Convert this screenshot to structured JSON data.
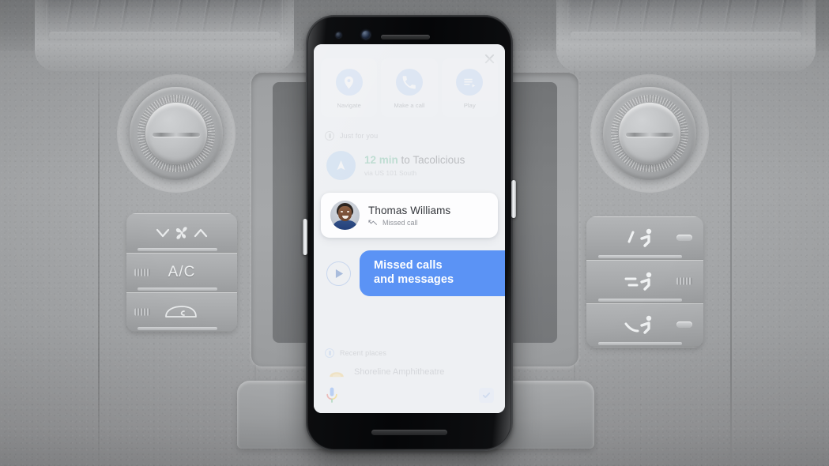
{
  "scene": {
    "description": "car-dashboard-with-phone",
    "dashboard": {
      "knob_left_label": "climate-knob-left",
      "knob_right_label": "climate-knob-right",
      "buttons": [
        {
          "id": "fan-control",
          "label": ""
        },
        {
          "id": "ac-button",
          "label": "A/C"
        },
        {
          "id": "recirculate-button",
          "label": ""
        },
        {
          "id": "vent-mode-face",
          "label": ""
        },
        {
          "id": "vent-mode-face-feet",
          "label": ""
        },
        {
          "id": "vent-mode-feet",
          "label": ""
        }
      ]
    }
  },
  "phone": {
    "assistant": {
      "quick_actions": [
        {
          "label": "Navigate",
          "icon": "map-pin-icon"
        },
        {
          "label": "Make a call",
          "icon": "phone-icon"
        },
        {
          "label": "Play",
          "icon": "playlist-play-icon"
        }
      ],
      "just_for_you": {
        "header": "Just for you",
        "header_icon": "clock-icon",
        "eta": "12 min",
        "destination": "to Tacolicious",
        "route": "via US 101 South",
        "nav_icon": "navigation-arrow-icon"
      },
      "contact_card": {
        "name": "Thomas Williams",
        "status": "Missed call",
        "status_icon": "missed-call-icon",
        "avatar": "contact-photo"
      },
      "banner": {
        "line1": "Missed calls",
        "line2": "and messages",
        "color": "#5b93f5",
        "play_icon": "play-circle-icon"
      },
      "recent_places": {
        "header": "Recent places",
        "header_icon": "recent-places-icon",
        "items": [
          {
            "name": "Shoreline Amphitheatre",
            "icon": "amphitheatre-icon"
          }
        ]
      },
      "input_bar": {
        "mic_icon": "assistant-mic-icon",
        "keyboard_icon": "keyboard-check-icon"
      },
      "close_label": "close-icon"
    }
  }
}
